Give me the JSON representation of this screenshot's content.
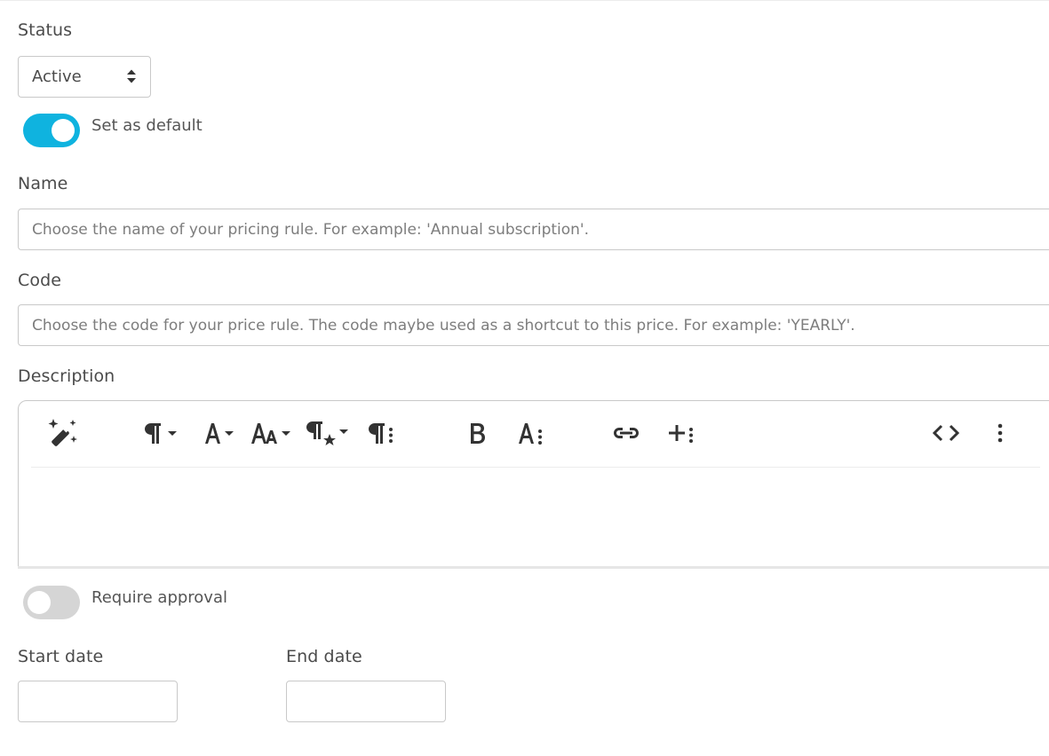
{
  "status": {
    "label": "Status",
    "selected": "Active"
  },
  "default_toggle": {
    "label": "Set as default",
    "on": true
  },
  "name": {
    "label": "Name",
    "value": "",
    "placeholder": "Choose the name of your pricing rule. For example: 'Annual subscription'."
  },
  "code": {
    "label": "Code",
    "value": "",
    "placeholder": "Choose the code for your price rule. The code maybe used as a shortcut to this price. For example: 'YEARLY'."
  },
  "description": {
    "label": "Description",
    "toolbar_icons": [
      "magic-wand-icon",
      "paragraph-format-icon",
      "font-family-icon",
      "font-size-icon",
      "paragraph-style-icon",
      "paragraph-more-icon",
      "bold-icon",
      "text-more-icon",
      "link-icon",
      "insert-more-icon",
      "code-view-icon",
      "more-vertical-icon"
    ]
  },
  "approval_toggle": {
    "label": "Require approval",
    "on": false
  },
  "start_date": {
    "label": "Start date",
    "value": ""
  },
  "end_date": {
    "label": "End date",
    "value": ""
  },
  "colors": {
    "accent": "#0fb3df",
    "toggle_off": "#d5d5d5",
    "border": "#c9c9c9",
    "text": "#4a4a4a"
  }
}
